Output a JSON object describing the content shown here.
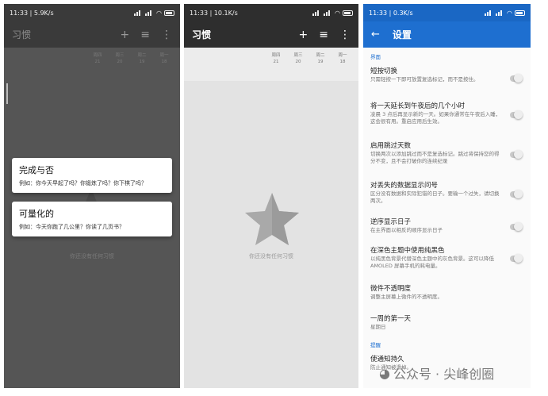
{
  "phone1": {
    "status": {
      "time": "11:33 | 5.9K/s",
      "alarm_icon": "alarm-icon"
    },
    "app_title": "习惯",
    "days": [
      {
        "dow": "周四",
        "date": "21"
      },
      {
        "dow": "周三",
        "date": "20"
      },
      {
        "dow": "周二",
        "date": "19"
      },
      {
        "dow": "周一",
        "date": "18"
      }
    ],
    "empty_text": "你还没有任何习惯",
    "menu": [
      {
        "title": "完成与否",
        "desc": "例如：你今天早起了吗？你锻炼了吗？你下棋了吗？"
      },
      {
        "title": "可量化的",
        "desc": "例如：今天你跑了几公里？你读了几页书？"
      }
    ]
  },
  "phone2": {
    "status": {
      "time": "11:33 | 10.1K/s"
    },
    "app_title": "习惯",
    "days": [
      {
        "dow": "周四",
        "date": "21"
      },
      {
        "dow": "周三",
        "date": "20"
      },
      {
        "dow": "周二",
        "date": "19"
      },
      {
        "dow": "周一",
        "date": "18"
      }
    ],
    "empty_text": "你还没有任何习惯"
  },
  "phone3": {
    "status": {
      "time": "11:33 | 0.3K/s"
    },
    "app_title": "设置",
    "section_interface": "界面",
    "items": [
      {
        "title": "短按切换",
        "desc": "只需轻按一下即可放置复选标记，而不是按住。",
        "toggle": true
      },
      {
        "title": "将一天延长到午夜后的几个小时",
        "desc": "凌晨 3 点后再显示新的一天。如果你通常在午夜后入睡，这会很有用。重启应用后生效。",
        "toggle": true
      },
      {
        "title": "启用跳过天数",
        "desc": "切换两次以添加跳过而不是复选标记。跳过将保持您的得分不变，且不会打破你的连续纪录",
        "toggle": true
      },
      {
        "title": "对丢失的数据显示问号",
        "desc": "区分没有数据和实际犯错的日子。要输一个过失，请切换两次。",
        "toggle": true
      },
      {
        "title": "逆序显示日子",
        "desc": "在主界面以相反的顺序显示日子",
        "toggle": true
      },
      {
        "title": "在深色主题中使用纯黑色",
        "desc": "以纯黑色背景代替深色主题中的灰色背景。这可以降低 AMOLED 屏幕手机的耗电量。",
        "toggle": true
      },
      {
        "title": "微件不透明度",
        "desc": "调整主屏幕上微件的不透明度。",
        "toggle": false
      },
      {
        "title": "一周的第一天",
        "desc": "星期日",
        "toggle": false
      }
    ],
    "section_reminder": "提醒",
    "partial_item": {
      "title": "使通知持久",
      "desc": "防止通知被滑掉。"
    }
  },
  "watermark": "公众号 · 尖峰创圈"
}
